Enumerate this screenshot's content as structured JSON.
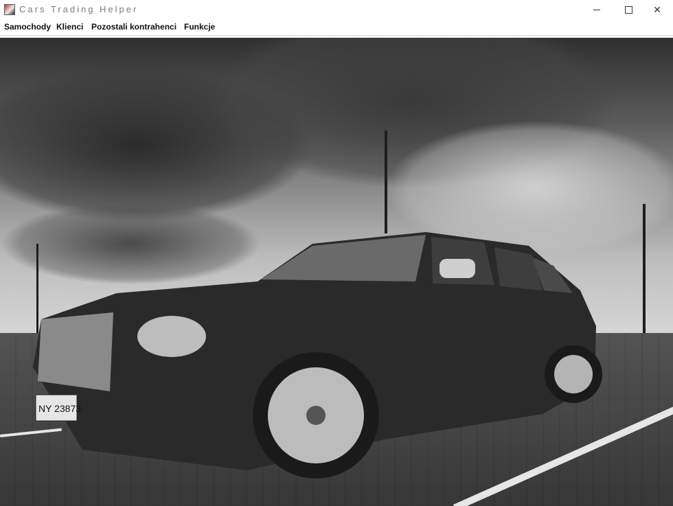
{
  "window": {
    "title": "Cars Trading Helper"
  },
  "menu": {
    "items": [
      "Samochody",
      "Klienci",
      "Pozostali kontrahenci",
      "Funkcje"
    ]
  },
  "content": {
    "image": "car-photo",
    "license_plate": "NY 23873"
  }
}
